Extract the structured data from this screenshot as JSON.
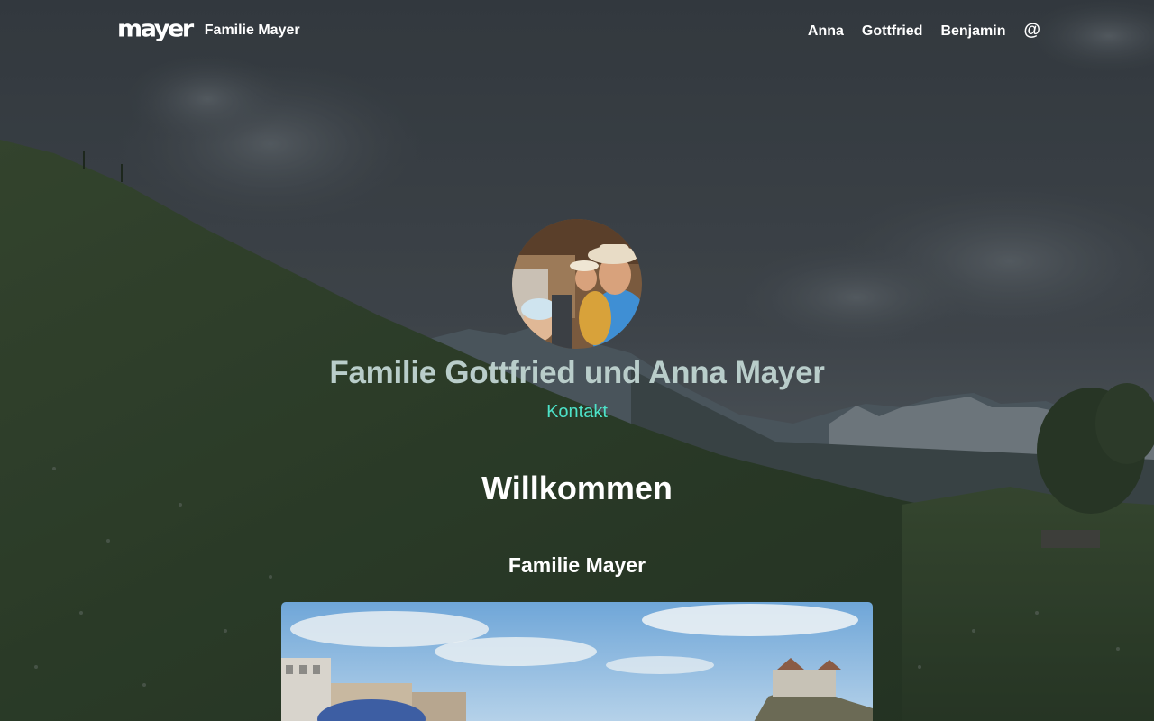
{
  "header": {
    "logo_text": "mayer",
    "site_name": "Familie Mayer",
    "nav": [
      {
        "label": "Anna"
      },
      {
        "label": "Gottfried"
      },
      {
        "label": "Benjamin"
      },
      {
        "label": "@"
      }
    ]
  },
  "hero": {
    "title": "Familie Gottfried und Anna Mayer",
    "contact_link": "Kontakt"
  },
  "content": {
    "section_title": "Willkommen",
    "subsection_title": "Familie Mayer"
  },
  "colors": {
    "accent_link": "#4de2c8",
    "hero_title": "#b9cdca",
    "overlay": "#2b3236"
  },
  "icons": {
    "contact": "at-icon"
  }
}
